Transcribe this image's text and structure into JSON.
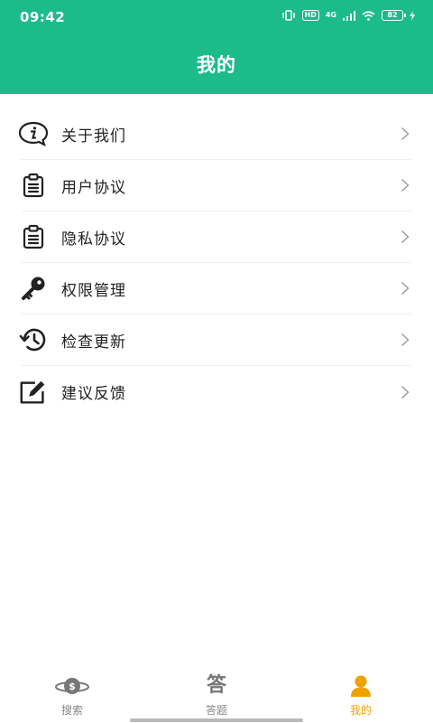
{
  "status_bar": {
    "time": "09:42",
    "hd_label": "HD",
    "network_label": "4G",
    "battery_level": "82"
  },
  "header": {
    "title": "我的"
  },
  "menu": {
    "items": [
      {
        "label": "关于我们",
        "icon": "info-icon"
      },
      {
        "label": "用户协议",
        "icon": "clipboard-icon"
      },
      {
        "label": "隐私协议",
        "icon": "clipboard-icon"
      },
      {
        "label": "权限管理",
        "icon": "key-icon"
      },
      {
        "label": "检查更新",
        "icon": "history-icon"
      },
      {
        "label": "建议反馈",
        "icon": "edit-icon"
      }
    ]
  },
  "tab_bar": {
    "tabs": [
      {
        "label": "搜索",
        "icon": "planet-search-icon",
        "active": false
      },
      {
        "label": "答题",
        "icon_text": "答",
        "active": false
      },
      {
        "label": "我的",
        "icon": "person-icon",
        "active": true
      }
    ]
  },
  "colors": {
    "primary": "#1bbb8a",
    "active_tab": "#f0a000",
    "inactive_tab": "#888888"
  }
}
